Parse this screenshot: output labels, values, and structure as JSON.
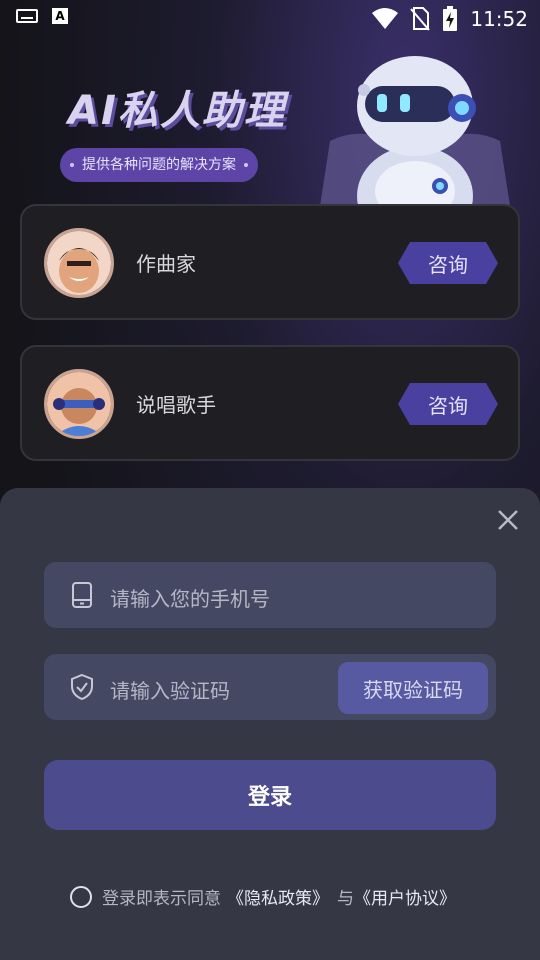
{
  "status_bar": {
    "time": "11:52",
    "icons": [
      "keyboard-icon",
      "a-app-icon",
      "wifi-icon",
      "no-sim-icon",
      "battery-charging-icon"
    ]
  },
  "banner": {
    "title": "AI私人助理",
    "subtitle": "提供各种问题的解决方案"
  },
  "assistants": [
    {
      "name": "作曲家",
      "button": "咨询"
    },
    {
      "name": "说唱歌手",
      "button": "咨询"
    }
  ],
  "login": {
    "phone_placeholder": "请输入您的手机号",
    "code_placeholder": "请输入验证码",
    "get_code_button": "获取验证码",
    "submit_button": "登录",
    "agreement_prefix": "登录即表示同意",
    "privacy_link": "《隐私政策》",
    "connector": "与",
    "terms_link": "《用户协议》"
  },
  "colors": {
    "accent": "#4a40a0",
    "sheet_bg": "#363745",
    "field_bg": "#454862"
  }
}
